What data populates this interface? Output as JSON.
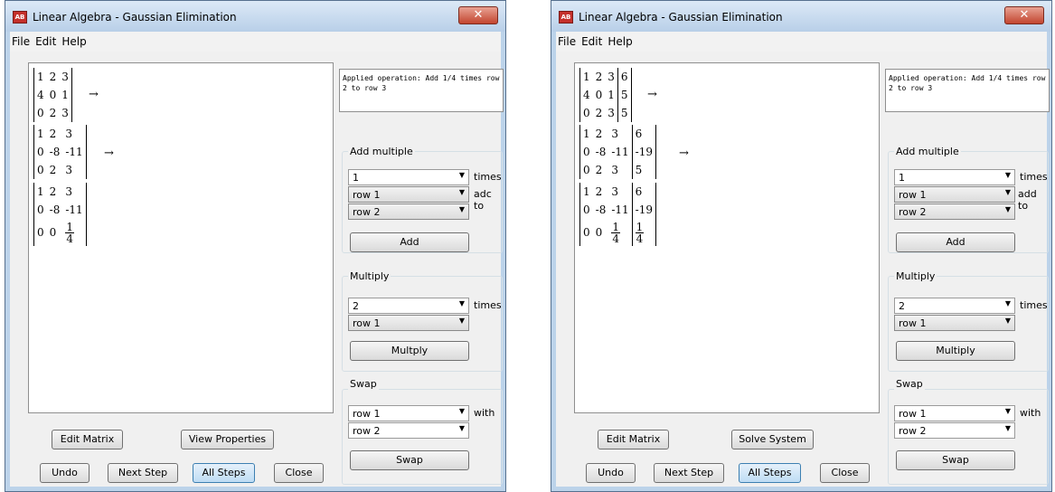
{
  "window_left": {
    "title": "Linear Algebra - Gaussian Elimination",
    "close_glyph": "✕",
    "menu": [
      "File",
      "Edit",
      "Help"
    ],
    "operation_text": "Applied operation:  Add 1/4 times row 2 to row 3",
    "matrices": [
      {
        "rows": [
          [
            "1",
            "2",
            "3"
          ],
          [
            "4",
            "0",
            "1"
          ],
          [
            "0",
            "2",
            "3"
          ]
        ]
      },
      {
        "rows": [
          [
            "1",
            "2",
            "3"
          ],
          [
            "0",
            "-8",
            "-11"
          ],
          [
            "0",
            "2",
            "3"
          ]
        ]
      },
      {
        "rows": [
          [
            "1",
            "2",
            "3"
          ],
          [
            "0",
            "-8",
            "-11"
          ],
          [
            "0",
            "0",
            "1/4"
          ]
        ]
      }
    ],
    "arrow": "→",
    "add_multiple": {
      "label": "Add multiple",
      "factor": "1",
      "times": "times",
      "source_row": "row 1",
      "to_label": "adc to",
      "target_row": "row 2",
      "button": "Add"
    },
    "multiply": {
      "label": "Multiply",
      "factor": "2",
      "times": "times",
      "row": "row 1",
      "button": "Multply"
    },
    "swap": {
      "label": "Swap",
      "row_a": "row 1",
      "with": "with",
      "row_b": "row 2",
      "button": "Swap"
    },
    "buttons": {
      "edit_matrix": "Edit Matrix",
      "secondary": "View Properties",
      "undo": "Undo",
      "next_step": "Next Step",
      "all_steps": "All Steps",
      "close": "Close"
    }
  },
  "window_right": {
    "title": "Linear Algebra - Gaussian Elimination",
    "close_glyph": "✕",
    "menu": [
      "File",
      "Edit",
      "Help"
    ],
    "operation_text": "Applied operation:  Add 1/4 times row 2 to row 3",
    "matrices": [
      {
        "rows": [
          [
            "1",
            "2",
            "3",
            "6"
          ],
          [
            "4",
            "0",
            "1",
            "5"
          ],
          [
            "0",
            "2",
            "3",
            "5"
          ]
        ]
      },
      {
        "rows": [
          [
            "1",
            "2",
            "3",
            "6"
          ],
          [
            "0",
            "-8",
            "-11",
            "-19"
          ],
          [
            "0",
            "2",
            "3",
            "5"
          ]
        ]
      },
      {
        "rows": [
          [
            "1",
            "2",
            "3",
            "6"
          ],
          [
            "0",
            "-8",
            "-11",
            "-19"
          ],
          [
            "0",
            "0",
            "1/4",
            "1/4"
          ]
        ]
      }
    ],
    "arrow": "→",
    "add_multiple": {
      "label": "Add multiple",
      "factor": "1",
      "times": "times",
      "source_row": "row 1",
      "to_label": "add to",
      "target_row": "row 2",
      "button": "Add"
    },
    "multiply": {
      "label": "Multiply",
      "factor": "2",
      "times": "times",
      "row": "row 1",
      "button": "Multiply"
    },
    "swap": {
      "label": "Swap",
      "row_a": "row 1",
      "with": "with",
      "row_b": "row 2",
      "button": "Swap"
    },
    "buttons": {
      "edit_matrix": "Edit Matrix",
      "secondary": "Solve System",
      "undo": "Undo",
      "next_step": "Next Step",
      "all_steps": "All Steps",
      "close": "Close"
    }
  },
  "colors": {
    "window_frame": "#bcd3ea",
    "client_bg": "#f0f0f0",
    "close_button": "#c3452f",
    "focus_button": "#bedcf4"
  }
}
